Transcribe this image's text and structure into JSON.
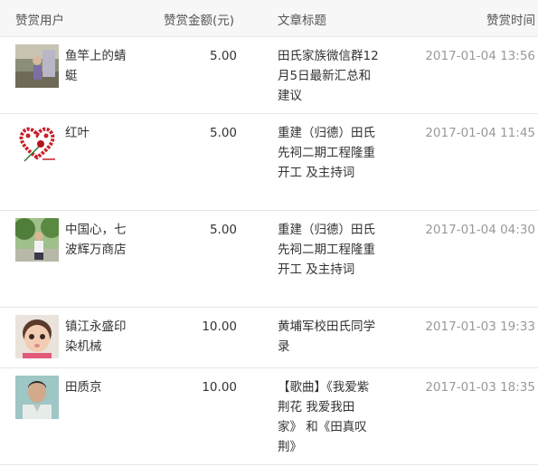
{
  "headers": {
    "user": "赞赏用户",
    "amount": "赞赏金额(元)",
    "title": "文章标题",
    "time": "赞赏时间"
  },
  "rows": [
    {
      "user": "鱼竿上的蜻蜓",
      "amount": "5.00",
      "title": "田氏家族微信群12月5日最新汇总和建议",
      "time": "2017-01-04 13:56",
      "avatar": "photo-avatar-person-outdoor"
    },
    {
      "user": "红叶",
      "amount": "5.00",
      "title": "重建（归德）田氏先祠二期工程隆重开工 及主持词",
      "time": "2017-01-04 11:45",
      "avatar": "rose-heart-avatar"
    },
    {
      "user": "中国心，七波辉万商店",
      "amount": "5.00",
      "title": "重建（归德）田氏先祠二期工程隆重开工 及主持词",
      "time": "2017-01-04 04:30",
      "avatar": "photo-avatar-person-trees"
    },
    {
      "user": "镇江永盛印染机械",
      "amount": "10.00",
      "title": "黄埔军校田氏同学录",
      "time": "2017-01-03 19:33",
      "avatar": "photo-avatar-baby"
    },
    {
      "user": "田质京",
      "amount": "10.00",
      "title": "【歌曲】《我爱紫荆花 我爱我田家》 和《田真叹荆》",
      "time": "2017-01-03 18:35",
      "avatar": "photo-avatar-man-portrait"
    }
  ]
}
